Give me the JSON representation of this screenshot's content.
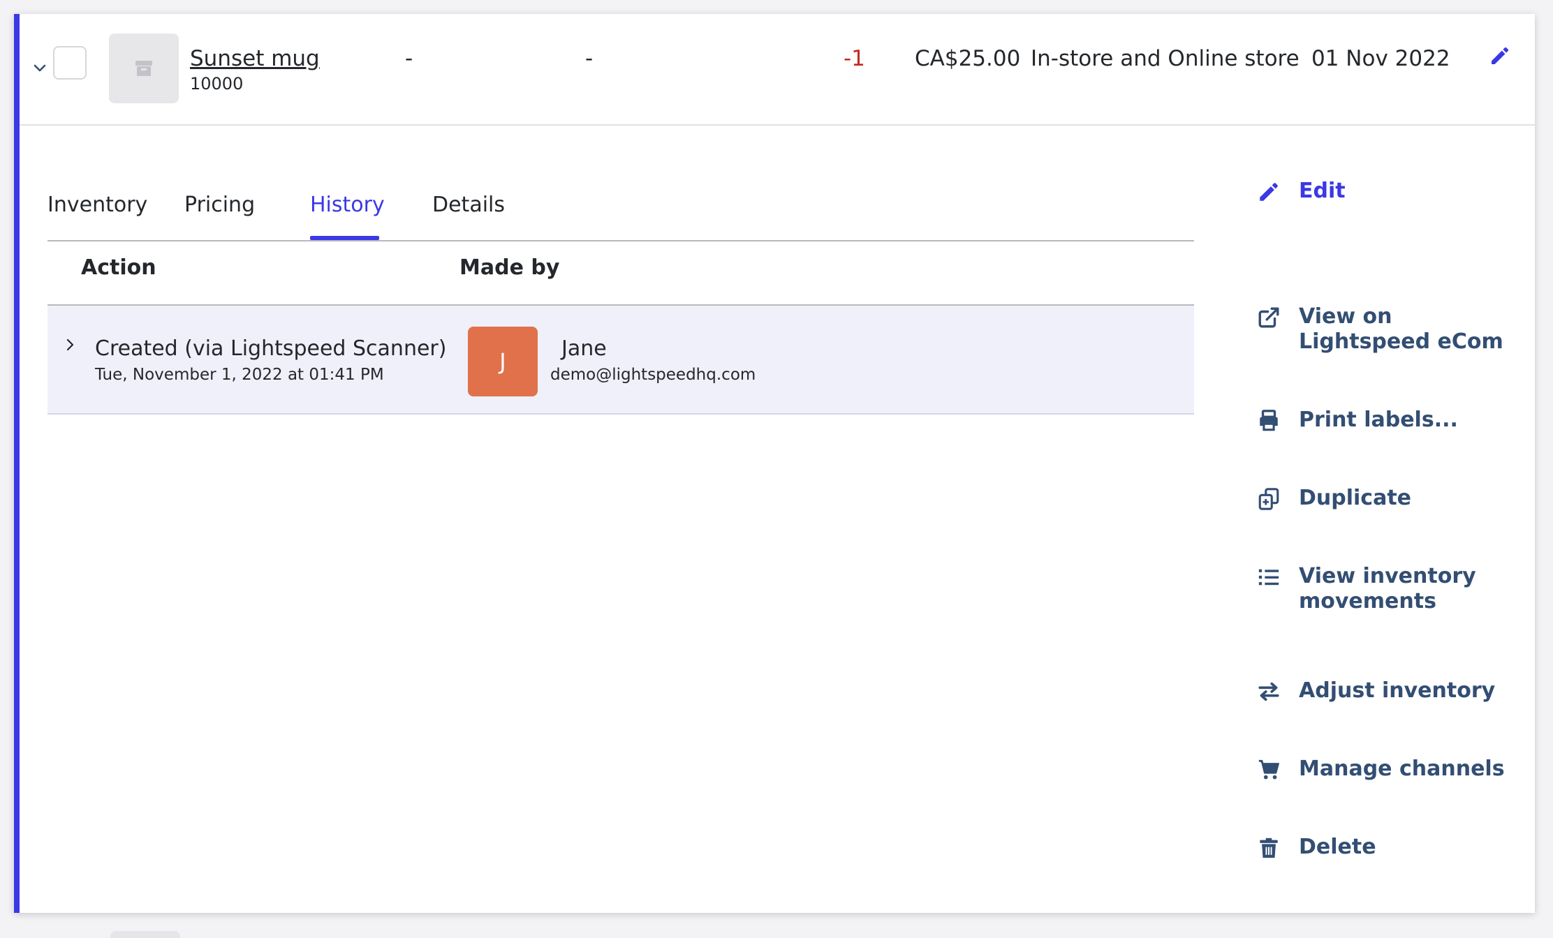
{
  "product": {
    "name": "Sunset mug",
    "sku": "10000",
    "col1": "-",
    "col2": "-",
    "quantity": "-1",
    "price": "CA$25.00",
    "channels": "In-store and Online store",
    "date": "01 Nov 2022"
  },
  "tabs": [
    {
      "label": "Inventory"
    },
    {
      "label": "Pricing"
    },
    {
      "label": "History",
      "active": true
    },
    {
      "label": "Details"
    }
  ],
  "history": {
    "columns": [
      "Action",
      "Made by"
    ],
    "rows": [
      {
        "action": "Created (via Lightspeed Scanner)",
        "timestamp": "Tue, November 1, 2022 at 01:41 PM",
        "user_initial": "J",
        "user_name": "Jane",
        "user_email": "demo@lightspeedhq.com"
      }
    ]
  },
  "side_actions": [
    {
      "label_lines": [
        "Edit"
      ],
      "icon": "pencil-icon"
    },
    {
      "label_lines": [
        "View on",
        "Lightspeed eCom"
      ],
      "icon": "external-link-icon"
    },
    {
      "label_lines": [
        "Print labels..."
      ],
      "icon": "printer-icon"
    },
    {
      "label_lines": [
        "Duplicate"
      ],
      "icon": "duplicate-icon"
    },
    {
      "label_lines": [
        "View inventory",
        "movements"
      ],
      "icon": "list-icon"
    },
    {
      "label_lines": [
        "Adjust inventory"
      ],
      "icon": "arrows-exchange-icon"
    },
    {
      "label_lines": [
        "Manage channels"
      ],
      "icon": "cart-icon"
    },
    {
      "label_lines": [
        "Delete"
      ],
      "icon": "trash-icon"
    }
  ],
  "colors": {
    "accent": "#3b38e5",
    "action_text": "#334e73",
    "negative": "#c4291d",
    "avatar": "#e0714a",
    "row_highlight": "#f0f0fb"
  }
}
